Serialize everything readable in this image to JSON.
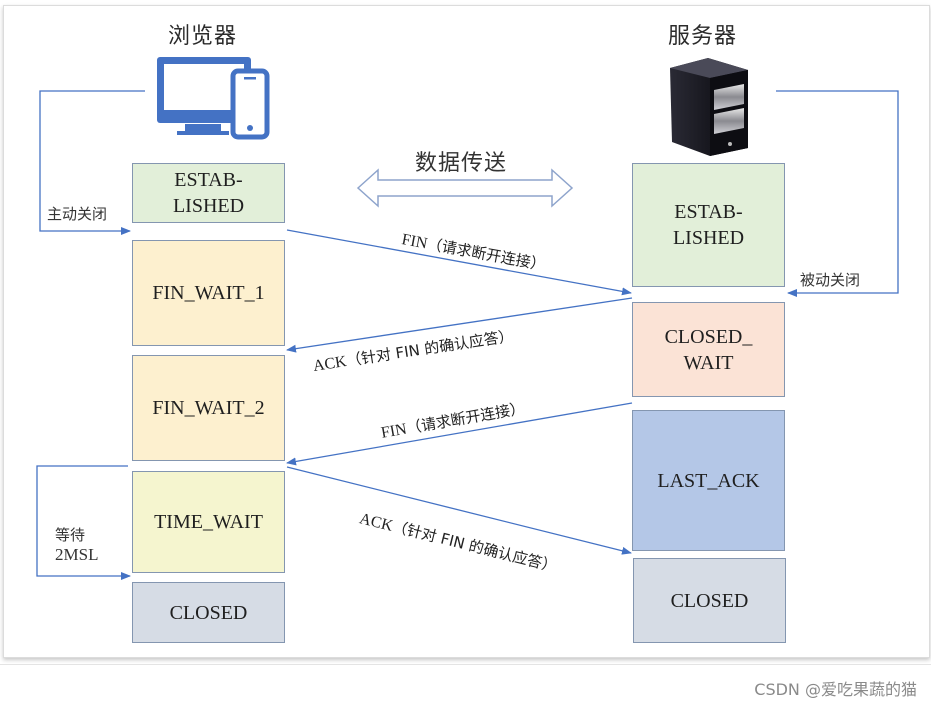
{
  "diagram": {
    "type": "TCP four-way handshake (connection termination)",
    "client": {
      "title": "浏览器",
      "icon": "desktop-and-phone-icon",
      "active_close_label": "主动关闭",
      "wait_label_line1": "等待",
      "wait_label_line2": "2MSL",
      "states": [
        {
          "id": "established",
          "label": "ESTAB-\nLISHED",
          "color": "#e2efd9"
        },
        {
          "id": "fin-wait-1",
          "label": "FIN_WAIT_1",
          "color": "#fdf0cf"
        },
        {
          "id": "fin-wait-2",
          "label": "FIN_WAIT_2",
          "color": "#fdf0cf"
        },
        {
          "id": "time-wait",
          "label": "TIME_WAIT",
          "color": "#f5f5cf"
        },
        {
          "id": "closed",
          "label": "CLOSED",
          "color": "#d6dce5"
        }
      ]
    },
    "server": {
      "title": "服务器",
      "icon": "server-tower-icon",
      "passive_close_label": "被动关闭",
      "states": [
        {
          "id": "established",
          "label": "ESTAB-\nLISHED",
          "color": "#e2efd9"
        },
        {
          "id": "closed-wait",
          "label": "CLOSED_\nWAIT",
          "color": "#fbe3d6"
        },
        {
          "id": "last-ack",
          "label": "LAST_ACK",
          "color": "#b4c7e7"
        },
        {
          "id": "closed",
          "label": "CLOSED",
          "color": "#d6dce5"
        }
      ]
    },
    "data_transfer_label": "数据传送",
    "messages": [
      {
        "id": "fin-1",
        "direction": "client-to-server",
        "en": "FIN",
        "cn": "（请求断开连接）"
      },
      {
        "id": "ack-1",
        "direction": "server-to-client",
        "en": "ACK",
        "cn": "（针对 FIN 的确认应答）"
      },
      {
        "id": "fin-2",
        "direction": "server-to-client",
        "en": "FIN",
        "cn": "（请求断开连接）"
      },
      {
        "id": "ack-2",
        "direction": "client-to-server",
        "en": "ACK",
        "cn": "（针对 FIN 的确认应答）"
      }
    ],
    "line_color": "#4472c4"
  },
  "watermark": "CSDN @爱吃果蔬的猫"
}
